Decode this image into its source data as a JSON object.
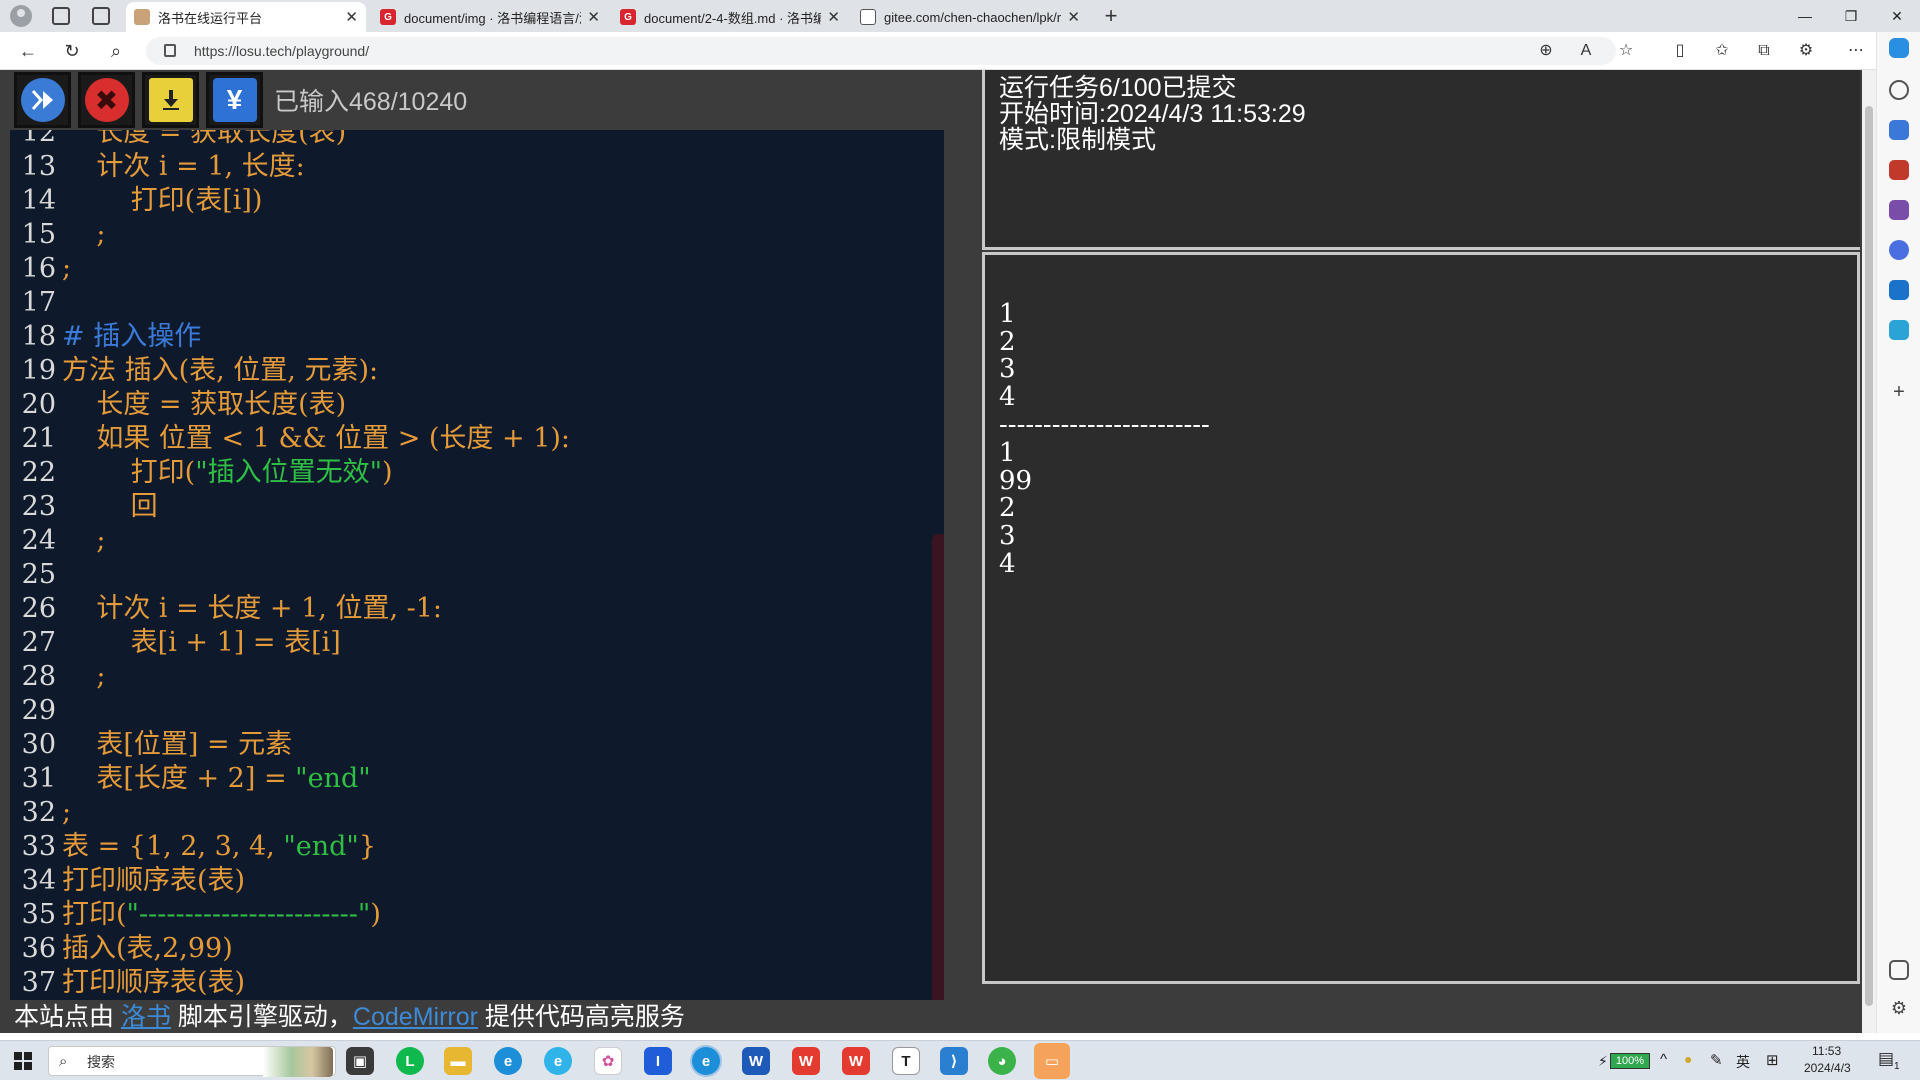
{
  "browser": {
    "tabs": [
      {
        "title": "洛书在线运行平台",
        "active": true
      },
      {
        "title": "document/img · 洛书编程语言/洛",
        "active": false
      },
      {
        "title": "document/2-4-数组.md · 洛书编",
        "active": false
      },
      {
        "title": "gitee.com/chen-chaochen/lpk/ra",
        "active": false
      }
    ],
    "url": "https://losu.tech/playground/"
  },
  "ide": {
    "input_count": "已输入468/10240",
    "buttons": {
      "run": "run-icon",
      "stop": "stop-icon",
      "download": "download-icon",
      "yuan": "¥"
    },
    "code_lines": [
      {
        "ln": "12",
        "code": "    长度 = 获取长度(表)"
      },
      {
        "ln": "13",
        "code": "    计次 i = 1, 长度:"
      },
      {
        "ln": "14",
        "code": "        打印(表[i])"
      },
      {
        "ln": "15",
        "code": "    ;"
      },
      {
        "ln": "16",
        "code": ";"
      },
      {
        "ln": "17",
        "code": ""
      },
      {
        "ln": "18",
        "code": "# 插入操作",
        "type": "comment"
      },
      {
        "ln": "19",
        "code": "方法 插入(表, 位置, 元素):"
      },
      {
        "ln": "20",
        "code": "    长度 = 获取长度(表)"
      },
      {
        "ln": "21",
        "code": "    如果 位置 < 1 && 位置 > (长度 + 1):"
      },
      {
        "ln": "22",
        "pre": "        打印(",
        "str": "\"插入位置无效\"",
        "post": ")"
      },
      {
        "ln": "23",
        "code": "        回"
      },
      {
        "ln": "24",
        "code": "    ;"
      },
      {
        "ln": "25",
        "code": ""
      },
      {
        "ln": "26",
        "code": "    计次 i = 长度 + 1, 位置, -1:"
      },
      {
        "ln": "27",
        "code": "        表[i + 1] = 表[i]"
      },
      {
        "ln": "28",
        "code": "    ;"
      },
      {
        "ln": "29",
        "code": ""
      },
      {
        "ln": "30",
        "code": "    表[位置] = 元素"
      },
      {
        "ln": "31",
        "pre": "    表[长度 + 2] = ",
        "str": "\"end\"",
        "post": ""
      },
      {
        "ln": "32",
        "code": ";"
      },
      {
        "ln": "33",
        "pre": "表 = {1, 2, 3, 4, ",
        "str": "\"end\"",
        "post": "}"
      },
      {
        "ln": "34",
        "code": "打印顺序表(表)"
      },
      {
        "ln": "35",
        "pre": "打印(",
        "str": "\"------------------------\"",
        "post": ")"
      },
      {
        "ln": "36",
        "code": "插入(表,2,99)"
      },
      {
        "ln": "37",
        "code": "打印顺序表(表)"
      }
    ],
    "footer": {
      "part1": "本站点由 ",
      "link1": "洛书",
      "part2": " 脚本引擎驱动，",
      "link2": "CodeMirror",
      "part3": " 提供代码高亮服务"
    }
  },
  "info": {
    "line1": "运行任务6/100已提交",
    "line2": "开始时间:2024/4/3 11:53:29",
    "line3": "模式:限制模式"
  },
  "output": {
    "lines": [
      "",
      "1",
      "2",
      "3",
      "4",
      "------------------------",
      "1",
      "99",
      "2",
      "3",
      "4"
    ]
  },
  "taskbar": {
    "search_placeholder": "搜索",
    "battery": "100%",
    "ime": "英",
    "time": "11:53",
    "date": "2024/4/3",
    "notification_count": "1"
  },
  "colors": {
    "code_keyword": "#e59b3a",
    "code_comment": "#3b7ad9",
    "code_string": "#2fbf45",
    "editor_bg": "#0e1a2b",
    "pane_bg": "#2c2c2c",
    "link": "#3d8ad6"
  }
}
